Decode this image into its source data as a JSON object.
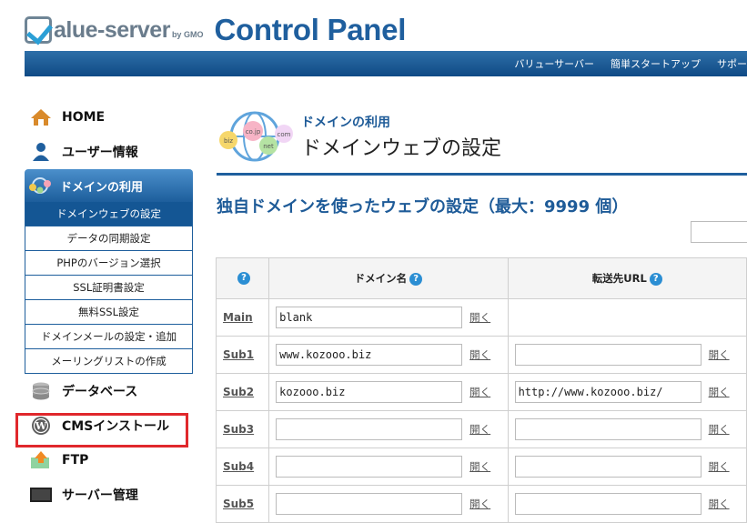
{
  "header": {
    "logo_text": "alue-server",
    "logo_gmo": "by GMO",
    "title": "Control Panel",
    "nav": [
      "バリューサーバー",
      "簡単スタートアップ",
      "サポー"
    ]
  },
  "sidebar": {
    "home": "HOME",
    "user_info": "ユーザー情報",
    "domain_use": "ドメインの利用",
    "sub_items": [
      "ドメインウェブの設定",
      "データの同期設定",
      "PHPのバージョン選択",
      "SSL証明書設定",
      "無料SSL設定",
      "ドメインメールの設定・追加",
      "メーリングリストの作成"
    ],
    "database": "データベース",
    "cms_install": "CMSインストール",
    "ftp": "FTP",
    "server_admin": "サーバー管理"
  },
  "main": {
    "category": "ドメインの利用",
    "title": "ドメインウェブの設定",
    "section_title": "独自ドメインを使ったウェブの設定（最大：9999 個）",
    "icon_labels": [
      "biz",
      "co.jp",
      "net",
      "com"
    ],
    "table": {
      "col_help": "?",
      "col_domain": "ドメイン名",
      "col_url": "転送先URL",
      "open_label": "開く",
      "rows": [
        {
          "name": "Main",
          "domain": "blank",
          "url": null
        },
        {
          "name": "Sub1",
          "domain": "www.kozooo.biz",
          "url": ""
        },
        {
          "name": "Sub2",
          "domain": "kozooo.biz",
          "url": "http://www.kozooo.biz/"
        },
        {
          "name": "Sub3",
          "domain": "",
          "url": ""
        },
        {
          "name": "Sub4",
          "domain": "",
          "url": ""
        },
        {
          "name": "Sub5",
          "domain": "",
          "url": ""
        }
      ]
    }
  },
  "colors": {
    "brand_blue": "#1f5f9e",
    "highlight_red": "#e0282c"
  }
}
